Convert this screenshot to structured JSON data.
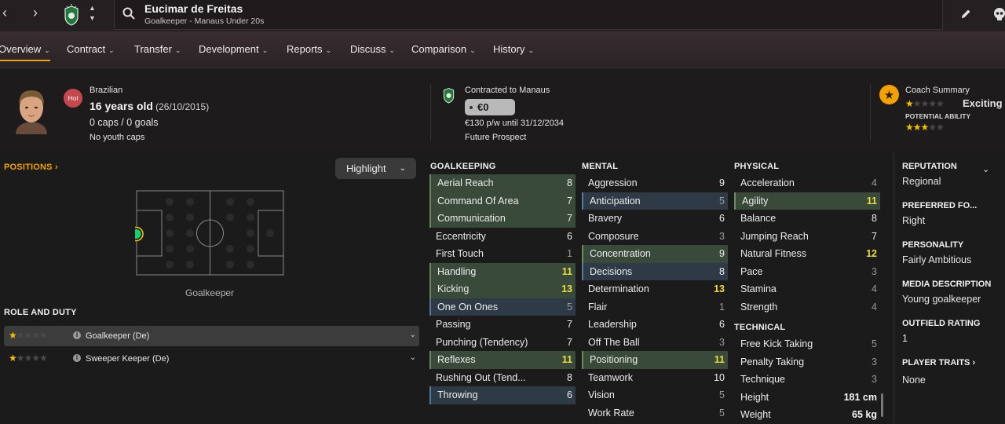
{
  "topbar": {
    "player_name": "Eucimar de Freitas",
    "player_subtitle": "Goalkeeper - Manaus Under 20s",
    "back_icon": "chevron-left-icon",
    "forward_icon": "chevron-right-icon"
  },
  "tabs": [
    {
      "label": "Overview"
    },
    {
      "label": "Contract"
    },
    {
      "label": "Transfer"
    },
    {
      "label": "Development"
    },
    {
      "label": "Reports"
    },
    {
      "label": "Discuss"
    },
    {
      "label": "Comparison"
    },
    {
      "label": "History"
    }
  ],
  "header": {
    "position_badge": "Hol",
    "nationality": "Brazilian",
    "age": "16 years old",
    "dob": "(26/10/2015)",
    "caps": "0 caps / 0 goals",
    "youth_caps": "No youth caps",
    "contract_title": "Contracted to Manaus",
    "value": "€0",
    "wage": "€130 p/w until 31/12/2034",
    "prospect": "Future Prospect",
    "coach_summary_title": "Coach Summary",
    "coach_summary_text": "Exciting y",
    "current_ability_stars": 1,
    "potential_label": "POTENTIAL ABILITY",
    "potential_ability_stars": 3
  },
  "positions": {
    "title": "POSITIONS",
    "highlight_label": "Highlight",
    "pitch_label": "Goalkeeper"
  },
  "role_duty": {
    "title": "ROLE AND DUTY",
    "roles": [
      {
        "name": "Goalkeeper (De)",
        "stars": 1
      },
      {
        "name": "Sweeper Keeper (De)",
        "stars": 1
      }
    ]
  },
  "goalkeeping": {
    "title": "GOALKEEPING",
    "attributes": [
      {
        "name": "Aerial Reach",
        "value": "8",
        "hl": "g"
      },
      {
        "name": "Command Of Area",
        "value": "7",
        "hl": "g"
      },
      {
        "name": "Communication",
        "value": "7",
        "hl": "g"
      },
      {
        "name": "Eccentricity",
        "value": "6",
        "hl": ""
      },
      {
        "name": "First Touch",
        "value": "1",
        "hl": ""
      },
      {
        "name": "Handling",
        "value": "11",
        "hl": "g"
      },
      {
        "name": "Kicking",
        "value": "13",
        "hl": "g"
      },
      {
        "name": "One On Ones",
        "value": "5",
        "hl": "b"
      },
      {
        "name": "Passing",
        "value": "7",
        "hl": ""
      },
      {
        "name": "Punching (Tendency)",
        "value": "7",
        "hl": ""
      },
      {
        "name": "Reflexes",
        "value": "11",
        "hl": "g"
      },
      {
        "name": "Rushing Out (Tend...",
        "value": "8",
        "hl": ""
      },
      {
        "name": "Throwing",
        "value": "6",
        "hl": "b"
      }
    ]
  },
  "mental": {
    "title": "MENTAL",
    "attributes": [
      {
        "name": "Aggression",
        "value": "9",
        "hl": ""
      },
      {
        "name": "Anticipation",
        "value": "5",
        "hl": "b"
      },
      {
        "name": "Bravery",
        "value": "6",
        "hl": ""
      },
      {
        "name": "Composure",
        "value": "3",
        "hl": ""
      },
      {
        "name": "Concentration",
        "value": "9",
        "hl": "g"
      },
      {
        "name": "Decisions",
        "value": "8",
        "hl": "b"
      },
      {
        "name": "Determination",
        "value": "13",
        "hl": ""
      },
      {
        "name": "Flair",
        "value": "1",
        "hl": ""
      },
      {
        "name": "Leadership",
        "value": "6",
        "hl": ""
      },
      {
        "name": "Off The Ball",
        "value": "3",
        "hl": ""
      },
      {
        "name": "Positioning",
        "value": "11",
        "hl": "g"
      },
      {
        "name": "Teamwork",
        "value": "10",
        "hl": ""
      },
      {
        "name": "Vision",
        "value": "5",
        "hl": ""
      },
      {
        "name": "Work Rate",
        "value": "5",
        "hl": ""
      }
    ]
  },
  "physical": {
    "title": "PHYSICAL",
    "attributes": [
      {
        "name": "Acceleration",
        "value": "4",
        "hl": ""
      },
      {
        "name": "Agility",
        "value": "11",
        "hl": "g"
      },
      {
        "name": "Balance",
        "value": "8",
        "hl": ""
      },
      {
        "name": "Jumping Reach",
        "value": "7",
        "hl": ""
      },
      {
        "name": "Natural Fitness",
        "value": "12",
        "hl": ""
      },
      {
        "name": "Pace",
        "value": "3",
        "hl": ""
      },
      {
        "name": "Stamina",
        "value": "4",
        "hl": ""
      },
      {
        "name": "Strength",
        "value": "4",
        "hl": ""
      }
    ]
  },
  "technical": {
    "title": "TECHNICAL",
    "attributes": [
      {
        "name": "Free Kick Taking",
        "value": "5",
        "hl": ""
      },
      {
        "name": "Penalty Taking",
        "value": "3",
        "hl": ""
      },
      {
        "name": "Technique",
        "value": "3",
        "hl": ""
      },
      {
        "name": "Height",
        "value": "181 cm",
        "hl": "",
        "bold": true
      },
      {
        "name": "Weight",
        "value": "65 kg",
        "hl": "",
        "bold": true
      }
    ]
  },
  "right_panel": {
    "reputation_title": "REPUTATION",
    "reputation": "Regional",
    "preferred_foot_title": "PREFERRED FO...",
    "preferred_foot": "Right",
    "personality_title": "PERSONALITY",
    "personality": "Fairly Ambitious",
    "media_title": "MEDIA DESCRIPTION",
    "media": "Young goalkeeper",
    "outfield_title": "OUTFIELD RATING",
    "outfield": "1",
    "traits_title": "PLAYER TRAITS",
    "traits": "None"
  },
  "colors": {
    "accent": "#f3a100",
    "highlight_green": "#3a4a3a",
    "highlight_blue": "#2e3b47",
    "value_high": "#eede3a"
  }
}
